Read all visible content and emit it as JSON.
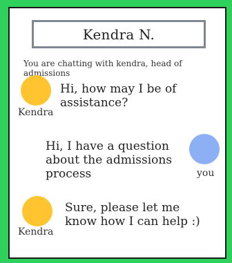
{
  "header": {
    "title": "Kendra N."
  },
  "intro": "You are chatting with kendra, head of admissions",
  "messages": [
    {
      "sender": "Kendra",
      "text": "Hi, how may I be of assistance?"
    },
    {
      "sender": "you",
      "text": "Hi, I have a question about the admissions process"
    },
    {
      "sender": "Kendra",
      "text": "Sure, please let me know how I can help :)"
    }
  ],
  "colors": {
    "background": "#2fd05b",
    "kendra_avatar": "#ffc430",
    "you_avatar": "#8db0f5",
    "header_border": "#7e8893"
  }
}
